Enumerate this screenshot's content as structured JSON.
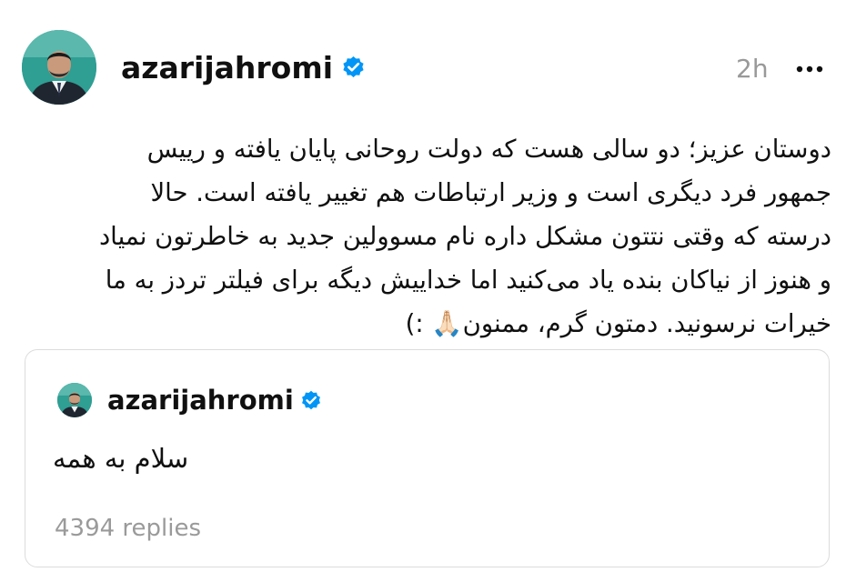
{
  "post": {
    "username": "azarijahromi",
    "verified": true,
    "timestamp": "2h",
    "more_icon": "more-horizontal-icon",
    "body_lines": [
      "دوستان عزیز؛ دو سالی هست که دولت روحانی پایان یافته و رییس",
      "جمهور فرد دیگری است و وزیر ارتباطات هم تغییر یافته است. حالا",
      "درسته که وقتی نتتون مشکل داره نام مسوولین جدید به خاطرتون نمیاد",
      "و هنوز از نیاکان بنده یاد می‌کنید اما خداییش دیگه برای فیلتر تردز به ما",
      "خیرات نرسونید. دمتون گرم، ممنون🙏🏻 :)"
    ]
  },
  "quoted_post": {
    "username": "azarijahromi",
    "verified": true,
    "text": "سلام به همه",
    "replies": "4394 replies"
  },
  "colors": {
    "verified_badge": "#0095f6",
    "muted_text": "#999999",
    "avatar_bg": "#2f9e93",
    "card_border": "#dcdcdc"
  }
}
